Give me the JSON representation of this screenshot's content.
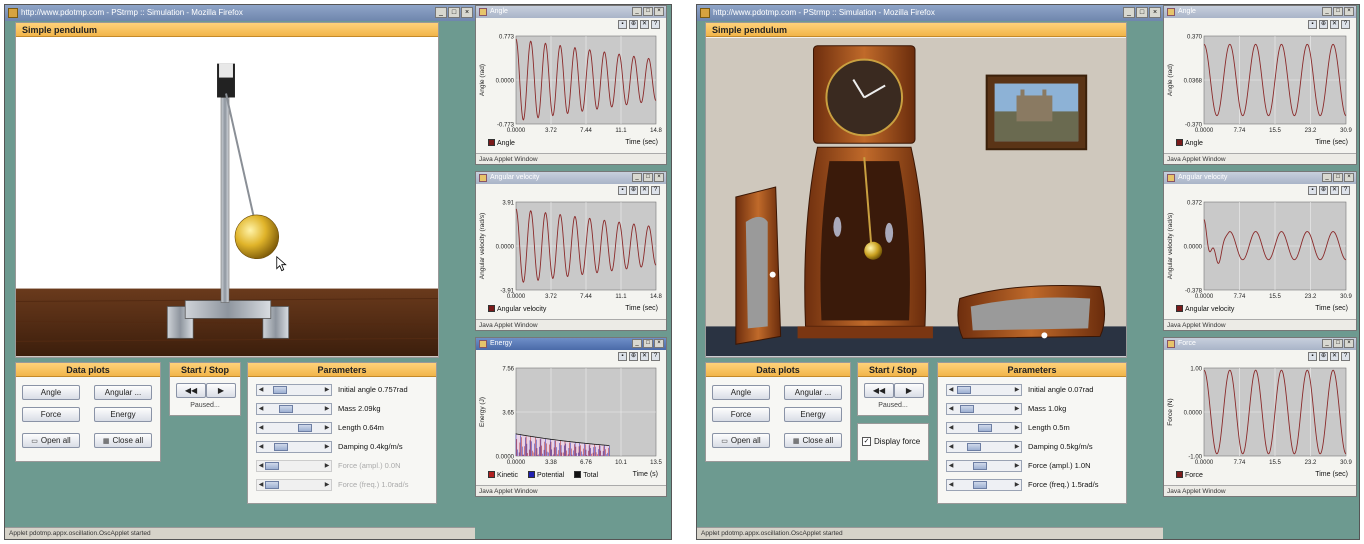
{
  "left": {
    "titlebar": "http://www.pdotmp.com - PStrmp :: Simulation - Mozilla Firefox",
    "sim_title": "Simple pendulum",
    "data_plots": {
      "title": "Data plots",
      "buttons": [
        "Angle",
        "Angular ...",
        "Force",
        "Energy"
      ],
      "open_all": "Open all",
      "close_all": "Close all"
    },
    "start_stop": {
      "title": "Start / Stop",
      "status": "Paused..."
    },
    "parameters": {
      "title": "Parameters",
      "items": [
        {
          "label": "Initial angle 0.757rad",
          "value": 0.18,
          "enabled": true
        },
        {
          "label": "Mass 2.09kg",
          "value": 0.3,
          "enabled": true
        },
        {
          "label": "Length 0.64m",
          "value": 0.72,
          "enabled": true
        },
        {
          "label": "Damping 0.4kg/m/s",
          "value": 0.2,
          "enabled": true
        },
        {
          "label": "Force (ampl.) 0.0N",
          "value": 0,
          "enabled": false
        },
        {
          "label": "Force (freq.) 1.0rad/s",
          "value": 0,
          "enabled": false
        }
      ]
    },
    "status_bar": "Applet pdotmp.appx.oscillation.OscApplet started",
    "graphs": [
      {
        "title": "Angle",
        "ylabel": "Angle (rad)",
        "xlabel": "Time (sec)",
        "yticks": [
          "0.773",
          "0.0000",
          "-0.773"
        ],
        "xticks": [
          "0.0000",
          "3.72",
          "7.44",
          "11.1",
          "14.8"
        ],
        "legend": [
          {
            "name": "Angle",
            "color": "#7a1a1a"
          }
        ],
        "footer": "Java Applet Window",
        "chart_data": {
          "type": "line",
          "x_range": [
            0,
            14.8
          ],
          "y_range": [
            -0.773,
            0.773
          ],
          "cycles": 9.5,
          "amplitude_start": 0.72,
          "amplitude_end": 0.36
        }
      },
      {
        "title": "Angular velocity",
        "ylabel": "Angular velocity (rad/s)",
        "xlabel": "Time (sec)",
        "yticks": [
          "3.91",
          "0.0000",
          "-3.91"
        ],
        "xticks": [
          "0.0000",
          "3.72",
          "7.44",
          "11.1",
          "14.8"
        ],
        "legend": [
          {
            "name": "Angular velocity",
            "color": "#7a1a1a"
          }
        ],
        "footer": "Java Applet Window",
        "chart_data": {
          "type": "line",
          "x_range": [
            0,
            14.8
          ],
          "y_range": [
            -3.91,
            3.91
          ],
          "cycles": 9.5,
          "amplitude_start": 3.3,
          "amplitude_end": 1.7
        }
      },
      {
        "title": "Energy",
        "ylabel": "Energy (J)",
        "xlabel": "Time (s)",
        "yticks": [
          "7.56",
          "3.65",
          "0.0000"
        ],
        "xticks": [
          "0.0000",
          "3.38",
          "6.76",
          "10.1",
          "13.5"
        ],
        "legend": [
          {
            "name": "Kinetic",
            "color": "#b02020"
          },
          {
            "name": "Potential",
            "color": "#2020b0"
          },
          {
            "name": "Total",
            "color": "#111111"
          }
        ],
        "footer": "Java Applet Window",
        "chart_data": {
          "type": "area",
          "x_range": [
            0,
            13.5
          ],
          "y_range": [
            0,
            7.56
          ],
          "total_start": 1.9,
          "total_end": 0.9,
          "x_end": 9.0
        }
      }
    ]
  },
  "right": {
    "titlebar": "http://www.pdotmp.com - PStrmp :: Simulation - Mozilla Firefox",
    "sim_title": "Simple pendulum",
    "data_plots": {
      "title": "Data plots",
      "buttons": [
        "Angle",
        "Angular ...",
        "Force",
        "Energy"
      ],
      "open_all": "Open all",
      "close_all": "Close all"
    },
    "start_stop": {
      "title": "Start / Stop",
      "status": "Paused..."
    },
    "display_force": "Display force",
    "parameters": {
      "title": "Parameters",
      "items": [
        {
          "label": "Initial angle 0.07rad",
          "value": 0.05,
          "enabled": true
        },
        {
          "label": "Mass 1.0kg",
          "value": 0.1,
          "enabled": true
        },
        {
          "label": "Length 0.5m",
          "value": 0.5,
          "enabled": true
        },
        {
          "label": "Damping 0.5kg/m/s",
          "value": 0.25,
          "enabled": true
        },
        {
          "label": "Force (ampl.) 1.0N",
          "value": 0.4,
          "enabled": true
        },
        {
          "label": "Force (freq.) 1.5rad/s",
          "value": 0.4,
          "enabled": true
        }
      ]
    },
    "status_bar": "Applet pdotmp.appx.oscillation.OscApplet started",
    "graphs": [
      {
        "title": "Angle",
        "ylabel": "Angle (rad)",
        "xlabel": "Time (sec)",
        "yticks": [
          "0.370",
          "0.0368",
          "-0.370"
        ],
        "xticks": [
          "0.0000",
          "7.74",
          "15.5",
          "23.2",
          "30.9"
        ],
        "legend": [
          {
            "name": "Angle",
            "color": "#7a1a1a"
          }
        ],
        "footer": "Java Applet Window",
        "chart_data": {
          "type": "line",
          "x_range": [
            0,
            30.9
          ],
          "y_range": [
            -0.37,
            0.37
          ],
          "cycles": 5.5,
          "amplitude_start": 0.3,
          "amplitude_end": 0.3
        }
      },
      {
        "title": "Angular velocity",
        "ylabel": "Angular velocity (rad/s)",
        "xlabel": "Time (sec)",
        "yticks": [
          "0.372",
          "0.0000",
          "-0.378"
        ],
        "xticks": [
          "0.0000",
          "7.74",
          "15.5",
          "23.2",
          "30.9"
        ],
        "legend": [
          {
            "name": "Angular velocity",
            "color": "#7a1a1a"
          }
        ],
        "footer": "Java Applet Window",
        "chart_data": {
          "type": "line",
          "x_range": [
            0,
            30.9
          ],
          "y_range": [
            -0.378,
            0.372
          ],
          "cycles": 5.5,
          "amplitude_start": 0.12,
          "amplitude_end": 0.12,
          "transient": true
        }
      },
      {
        "title": "Force",
        "ylabel": "Force (N)",
        "xlabel": "Time (sec)",
        "yticks": [
          "1.00",
          "0.0000",
          "-1.00"
        ],
        "xticks": [
          "0.0000",
          "7.74",
          "15.5",
          "23.2",
          "30.9"
        ],
        "legend": [
          {
            "name": "Force",
            "color": "#7a1a1a"
          }
        ],
        "footer": "Java Applet Window",
        "chart_data": {
          "type": "line",
          "x_range": [
            0,
            30.9
          ],
          "y_range": [
            -1,
            1
          ],
          "cycles": 5.5,
          "amplitude_start": 0.95,
          "amplitude_end": 0.95
        }
      }
    ]
  }
}
